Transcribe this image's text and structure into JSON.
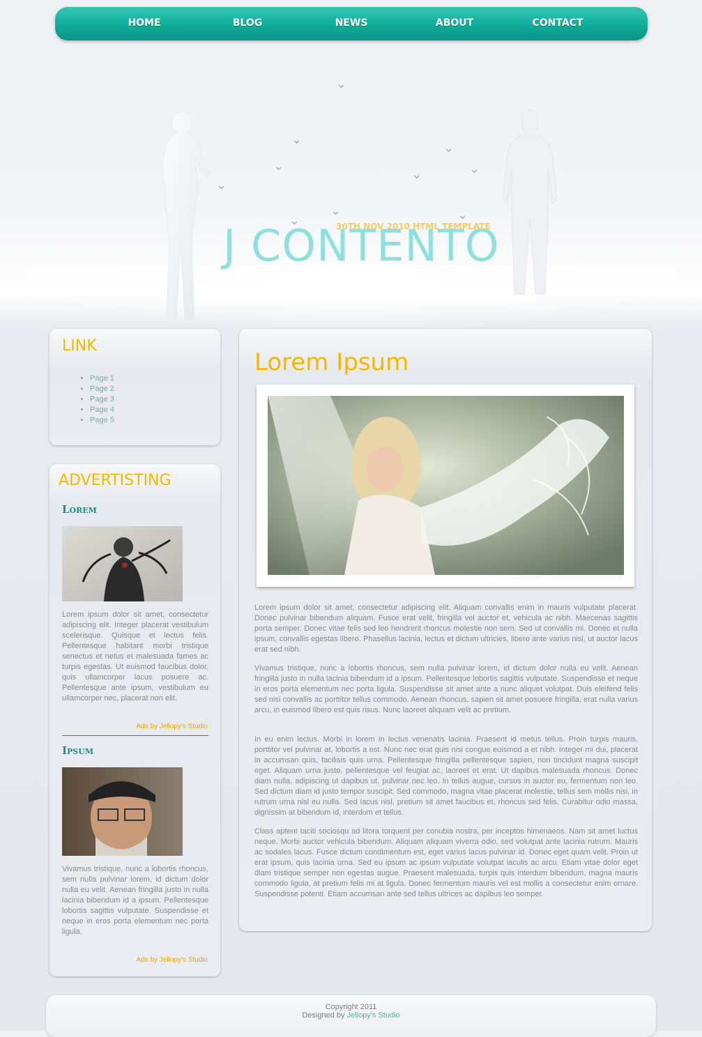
{
  "nav": {
    "items": [
      "HOME",
      "BLOG",
      "NEWS",
      "ABOUT",
      "CONTACT"
    ]
  },
  "hero": {
    "title": "J CONTENTO",
    "subtitle": "30TH NOV 2010 HTML TEMPLATE"
  },
  "sidebar": {
    "link_title": "LINK",
    "links": [
      "Page 1",
      "Page 2",
      "Page 3",
      "Page 4",
      "Page 5"
    ],
    "ad_title": "ADVERTISTING",
    "ads": [
      {
        "title": "Lorem",
        "text": "Lorem ipsum dolor sit amet, consectetur adipiscing elit. Integer placerat vestibulum scelerisque. Quisque et lectus felis. Pellentesque habitant morbi tristique senectus et netus et malesuada fames ac turpis egestas. Ut euismod faucibus dolor, quis ullamcorper lacus posuere ac. Pellentesque ante ipsum, vestibulum eu ullamcorper nec, placerat non elit.",
        "by": "Ads by Jellopy's Studio"
      },
      {
        "title": "Ipsum",
        "text": "Vivamus tristique, nunc a lobortis rhoncus, sem nulla pulvinar lorem, id dictum dolor nulla eu velit. Aenean fringilla justo in nulla lacinia bibendum id a ipsum. Pellentesque lobortis sagittis vulputate. Suspendisse et neque in eros porta elementum nec porta ligula.",
        "by": "Ads by Jellopy's Studio"
      }
    ]
  },
  "main": {
    "title": "Lorem Ipsum",
    "paragraphs": [
      "Lorem ipsum dolor sit amet, consectetur adipiscing elit. Aliquam convallis enim in mauris vulputate placerat. Donec pulvinar bibendum aliquam. Fusce erat velit, fringilla vel auctor et, vehicula ac nibh. Maecenas sagittis porta semper. Donec vitae felis sed leo hendrerit rhoncus molestie non sem. Sed ut convallis mi. Donec et nulla ipsum, convallis egestas libero. Phasellus lacinia, lectus et dictum ultricies, libero ante varius nisl, ut auctor lacus erat sed nibh.",
      "Vivamus tristique, nunc a lobortis rhoncus, sem nulla pulvinar lorem, id dictum dolor nulla eu velit. Aenean fringilla justo in nulla lacinia bibendum id a ipsum. Pellentesque lobortis sagittis vulputate. Suspendisse et neque in eros porta elementum nec porta ligula. Suspendisse sit amet ante a nunc aliquet volutpat. Duis eleifend felis sed nisi convallis ac porttitor tellus commodo. Aenean rhoncus, sapien sit amet posuere fringilla, erat nulla varius arcu, in euismod libero est quis risus. Nunc laoreet aliquam velit ac pretium.",
      "In eu enim lectus. Morbi in lorem in lectus venenatis lacinia. Praesent id metus tellus. Proin turpis mauris, porttitor vel pulvinar at, lobortis a est. Nunc nec erat quis nisi congue euismod a et nibh. Integer mi dui, placerat in accumsan quis, facilisis quis urna. Pellentesque fringilla pellentesque sapien, non tincidunt magna suscipit eget. Aliquam urna justo, pellentesque vel feugiat ac, laoreet et erat. Ut dapibus malesuada rhoncus. Donec diam nulla, adipiscing ut dapibus ut, pulvinar nec leo. In tellus augue, cursus in auctor eu, fermentum non leo. Sed dictum diam id justo tempor suscipit. Sed commodo, magna vitae placerat molestie, tellus sem mollis nisi, in rutrum urna nisl eu nulla. Sed lacus nisl, pretium sit amet faucibus et, rhoncus sed felis. Curabitur odio massa, dignissim at bibendum id, interdum et tellus.",
      "Class aptent taciti sociosqu ad litora torquent per conubia nostra, per inceptos himenaeos. Nam sit amet luctus neque. Morbi auctor vehicula bibendum. Aliquam aliquam viverra odio, sed volutpat ante lacinia rutrum. Mauris ac sodales lacus. Fusce dictum condimentum est, eget varius lacus pulvinar id. Donec eget quam velit. Proin ut erat ipsum, quis lacinia urna. Sed eu ipsum ac ipsum vulputate volutpat iaculis ac arcu. Etiam vitae dolor eget diam tristique semper non egestas augue. Praesent malesuada, turpis quis interdum bibendum, magna mauris commodo ligula, at pretium felis mi at ligula. Donec fermentum mauris vel est mollis a consectetur enim ornare. Suspendisse potenti. Etiam accumsan ante sed tellus ultrices ac dapibus leo semper."
    ]
  },
  "footer": {
    "copyright": "Copyright 2011",
    "designed_by": "Designed by",
    "designer": "Jellopy's Studio"
  }
}
